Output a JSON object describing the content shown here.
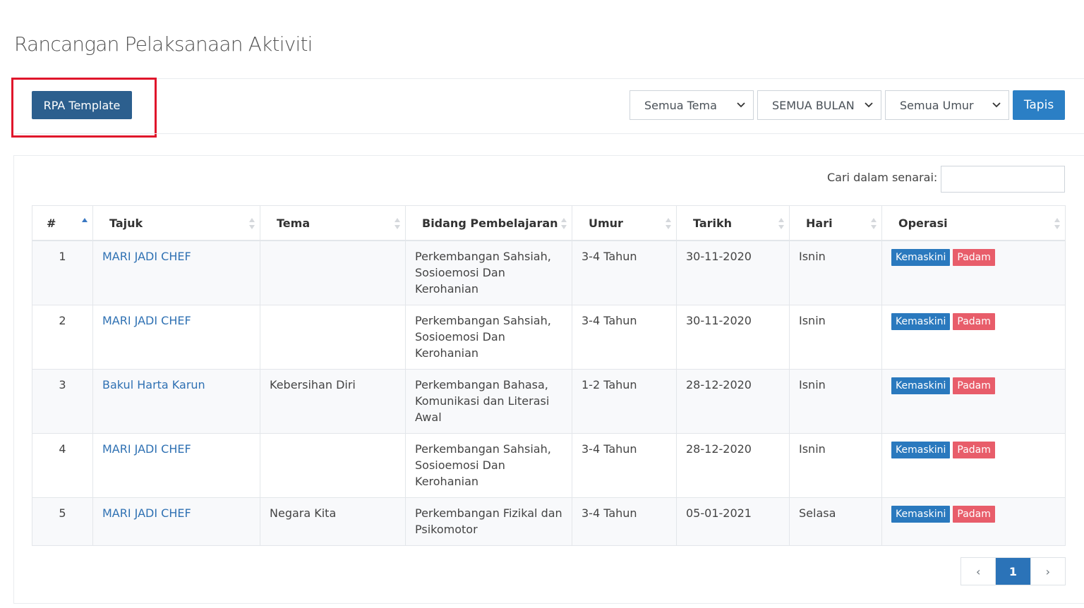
{
  "page": {
    "title": "Rancangan Pelaksanaan Aktiviti"
  },
  "toolbar": {
    "rpa_template_label": "RPA Template",
    "filter_tema": "Semua Tema",
    "filter_bulan": "SEMUA BULAN",
    "filter_umur": "Semua Umur",
    "tapis_label": "Tapis"
  },
  "search": {
    "label": "Cari dalam senarai:",
    "value": ""
  },
  "table": {
    "headers": [
      "#",
      "Tajuk",
      "Tema",
      "Bidang Pembelajaran",
      "Umur",
      "Tarikh",
      "Hari",
      "Operasi"
    ],
    "rows": [
      {
        "no": "1",
        "tajuk": "MARI JADI CHEF",
        "tema": "",
        "bidang": "Perkembangan Sahsiah, Sosioemosi Dan Kerohanian",
        "umur": "3-4 Tahun",
        "tarikh": "30-11-2020",
        "hari": "Isnin"
      },
      {
        "no": "2",
        "tajuk": "MARI JADI CHEF",
        "tema": "",
        "bidang": "Perkembangan Sahsiah, Sosioemosi Dan Kerohanian",
        "umur": "3-4 Tahun",
        "tarikh": "30-11-2020",
        "hari": "Isnin"
      },
      {
        "no": "3",
        "tajuk": "Bakul Harta Karun",
        "tema": "Kebersihan Diri",
        "bidang": "Perkembangan Bahasa, Komunikasi dan Literasi Awal",
        "umur": "1-2 Tahun",
        "tarikh": "28-12-2020",
        "hari": "Isnin"
      },
      {
        "no": "4",
        "tajuk": "MARI JADI CHEF",
        "tema": "",
        "bidang": "Perkembangan Sahsiah, Sosioemosi Dan Kerohanian",
        "umur": "3-4 Tahun",
        "tarikh": "28-12-2020",
        "hari": "Isnin"
      },
      {
        "no": "5",
        "tajuk": "MARI JADI CHEF",
        "tema": "Negara Kita",
        "bidang": "Perkembangan Fizikal dan Psikomotor",
        "umur": "3-4 Tahun",
        "tarikh": "05-01-2021",
        "hari": "Selasa"
      }
    ],
    "edit_label": "Kemaskini",
    "delete_label": "Padam"
  },
  "pagination": {
    "prev": "‹",
    "current": "1",
    "next": "›"
  },
  "colors": {
    "primary": "#2c5f8e",
    "accent": "#2b7fc5",
    "danger": "#e85d6a",
    "highlight": "#e0162b",
    "link": "#2f71b3"
  }
}
